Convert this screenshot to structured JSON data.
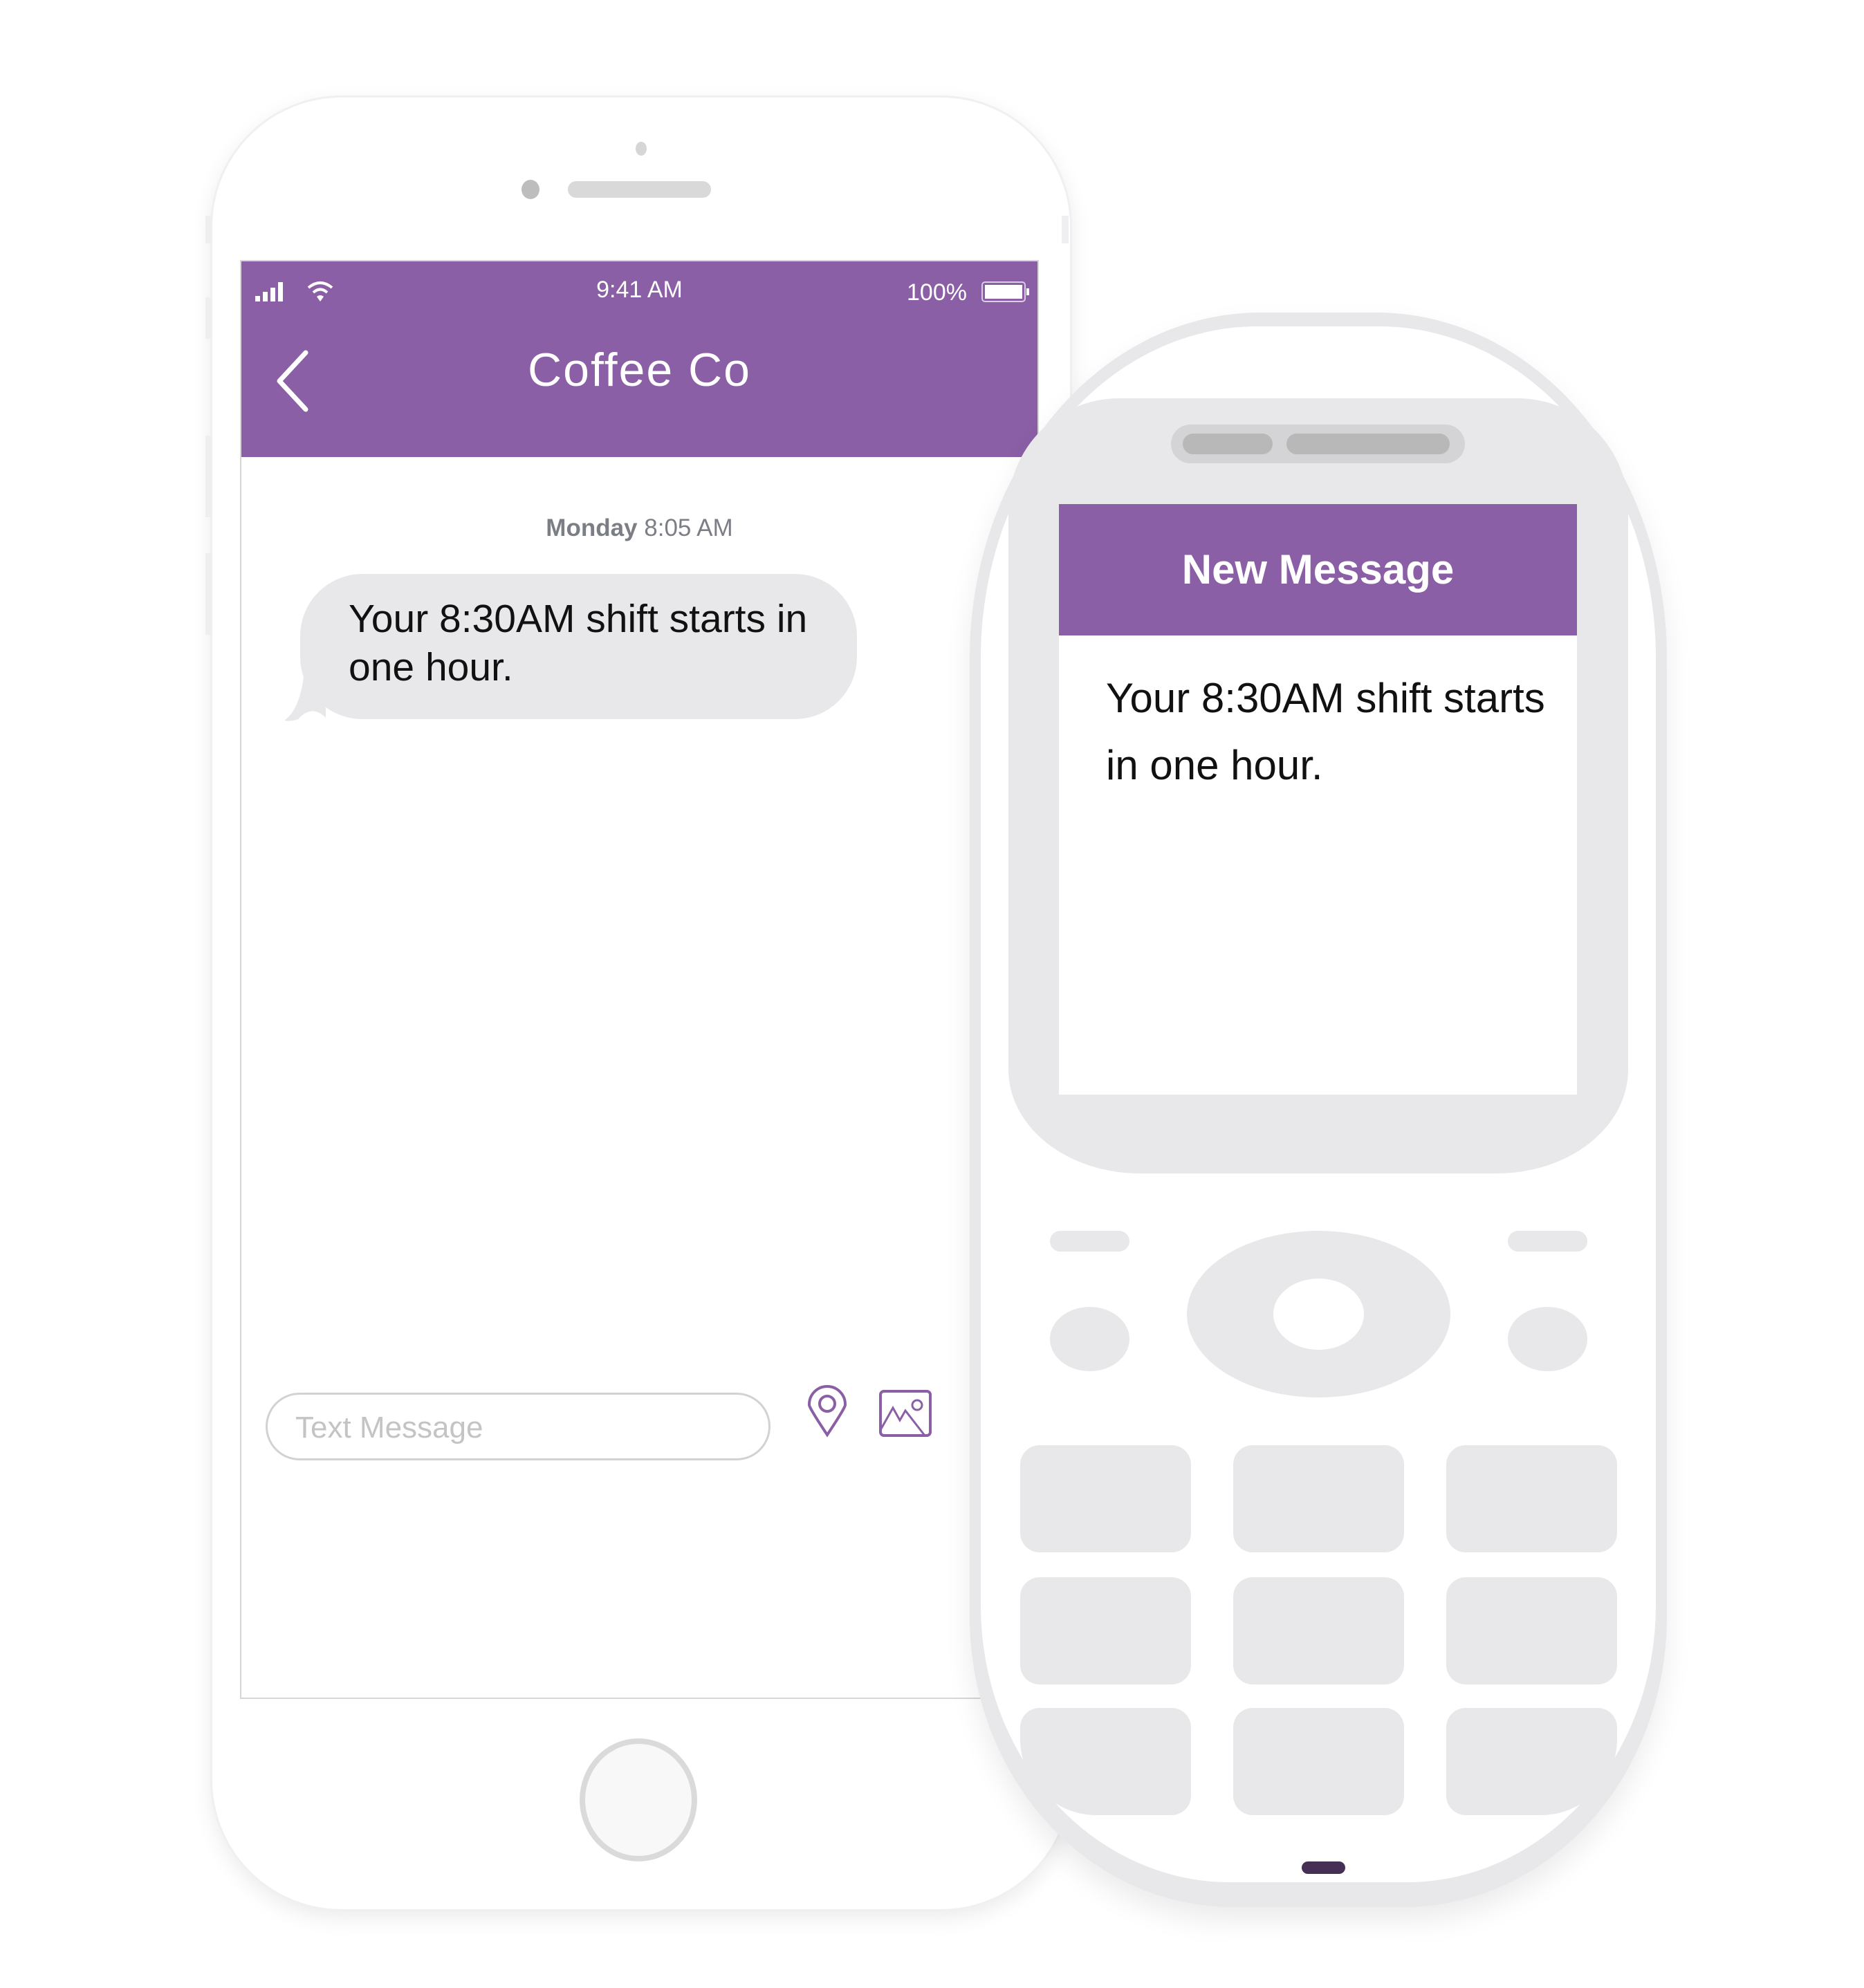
{
  "smartphone": {
    "status_bar": {
      "time": "9:41 AM",
      "battery": "100%",
      "signal_icon": "signal-bars-icon",
      "wifi_icon": "wifi-icon",
      "battery_icon": "battery-icon"
    },
    "header": {
      "title": "Coffee Co",
      "back_icon": "chevron-left-icon"
    },
    "conversation": {
      "timestamp_day": "Monday",
      "timestamp_time": "8:05 AM",
      "messages": [
        {
          "text": "Your 8:30AM shift starts in one hour.",
          "direction": "incoming"
        }
      ]
    },
    "composer": {
      "placeholder": "Text Message",
      "value": "",
      "location_icon": "location-pin-icon",
      "image_icon": "image-icon"
    }
  },
  "feature_phone": {
    "header": "New Message",
    "message": "Your 8:30AM shift starts in one hour."
  },
  "colors": {
    "accent": "#8a5fa5",
    "bubble": "#e8e8ea",
    "indicator": "#452f55"
  }
}
